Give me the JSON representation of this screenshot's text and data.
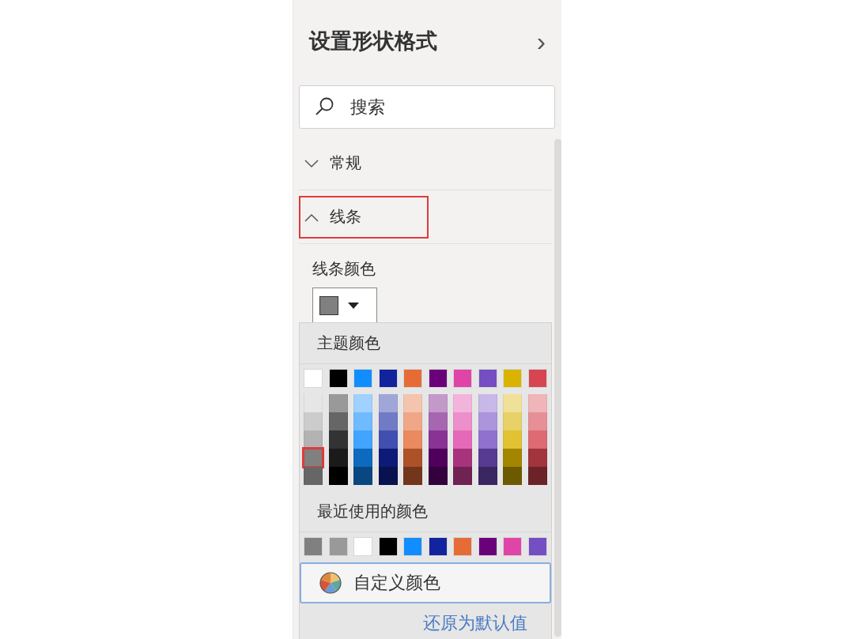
{
  "pane": {
    "title": "设置形状格式",
    "collapse_icon": "›"
  },
  "search": {
    "placeholder": "搜索"
  },
  "sections": [
    {
      "label": "常规",
      "expanded": false,
      "highlighted": false
    },
    {
      "label": "线条",
      "expanded": true,
      "highlighted": true
    }
  ],
  "line_color": {
    "label": "线条颜色",
    "color": "#808080"
  },
  "color_picker": {
    "theme_title": "主题颜色",
    "theme_columns": [
      {
        "color": "#ffffff",
        "shades": [
          {
            "color": "#e6e6e6",
            "selected": false
          },
          {
            "color": "#cccccc",
            "selected": false
          },
          {
            "color": "#b3b3b3",
            "selected": false
          },
          {
            "color": "#808080",
            "selected": true
          },
          {
            "color": "#666666",
            "selected": false
          }
        ]
      },
      {
        "color": "#000000",
        "shades": [
          {
            "color": "#999999",
            "selected": false
          },
          {
            "color": "#666666",
            "selected": false
          },
          {
            "color": "#333333",
            "selected": false
          },
          {
            "color": "#1a1a1a",
            "selected": false
          },
          {
            "color": "#000000",
            "selected": false
          }
        ]
      },
      {
        "color": "#118dff",
        "shades": [
          {
            "color": "#a0d1ff",
            "selected": false
          },
          {
            "color": "#70bbff",
            "selected": false
          },
          {
            "color": "#41a4ff",
            "selected": false
          },
          {
            "color": "#0d6abf",
            "selected": false
          },
          {
            "color": "#094780",
            "selected": false
          }
        ]
      },
      {
        "color": "#12239e",
        "shades": [
          {
            "color": "#a0a7d8",
            "selected": false
          },
          {
            "color": "#717bc5",
            "selected": false
          },
          {
            "color": "#414fb1",
            "selected": false
          },
          {
            "color": "#0d1a77",
            "selected": false
          },
          {
            "color": "#09124f",
            "selected": false
          }
        ]
      },
      {
        "color": "#e66c37",
        "shades": [
          {
            "color": "#f5c4af",
            "selected": false
          },
          {
            "color": "#f0a787",
            "selected": false
          },
          {
            "color": "#eb895f",
            "selected": false
          },
          {
            "color": "#ad5129",
            "selected": false
          },
          {
            "color": "#73361c",
            "selected": false
          }
        ]
      },
      {
        "color": "#6b007b",
        "shades": [
          {
            "color": "#c399ca",
            "selected": false
          },
          {
            "color": "#a666b0",
            "selected": false
          },
          {
            "color": "#893395",
            "selected": false
          },
          {
            "color": "#50005c",
            "selected": false
          },
          {
            "color": "#35003e",
            "selected": false
          }
        ]
      },
      {
        "color": "#e044a7",
        "shades": [
          {
            "color": "#f3b4dc",
            "selected": false
          },
          {
            "color": "#ec8fca",
            "selected": false
          },
          {
            "color": "#e669b9",
            "selected": false
          },
          {
            "color": "#a8337d",
            "selected": false
          },
          {
            "color": "#702253",
            "selected": false
          }
        ]
      },
      {
        "color": "#744ec2",
        "shades": [
          {
            "color": "#c7b8e7",
            "selected": false
          },
          {
            "color": "#ac95da",
            "selected": false
          },
          {
            "color": "#9071ce",
            "selected": false
          },
          {
            "color": "#573b92",
            "selected": false
          },
          {
            "color": "#3a2761",
            "selected": false
          }
        ]
      },
      {
        "color": "#d9b300",
        "shades": [
          {
            "color": "#f0e199",
            "selected": false
          },
          {
            "color": "#e8d166",
            "selected": false
          },
          {
            "color": "#e1c233",
            "selected": false
          },
          {
            "color": "#a38600",
            "selected": false
          },
          {
            "color": "#6d5a00",
            "selected": false
          }
        ]
      },
      {
        "color": "#d64550",
        "shades": [
          {
            "color": "#efb5b9",
            "selected": false
          },
          {
            "color": "#e68f96",
            "selected": false
          },
          {
            "color": "#de6a73",
            "selected": false
          },
          {
            "color": "#a1343c",
            "selected": false
          },
          {
            "color": "#6b2328",
            "selected": false
          }
        ]
      }
    ],
    "recent_title": "最近使用的颜色",
    "recent_colors": [
      {
        "color": "#808080"
      },
      {
        "color": "#999999"
      },
      {
        "color": "#ffffff"
      },
      {
        "color": "#000000"
      },
      {
        "color": "#118dff"
      },
      {
        "color": "#12239e"
      },
      {
        "color": "#e66c37"
      },
      {
        "color": "#6b007b"
      },
      {
        "color": "#e044a7"
      },
      {
        "color": "#744ec2"
      }
    ],
    "custom_button": "自定义颜色",
    "reset_link": "还原为默认值"
  }
}
